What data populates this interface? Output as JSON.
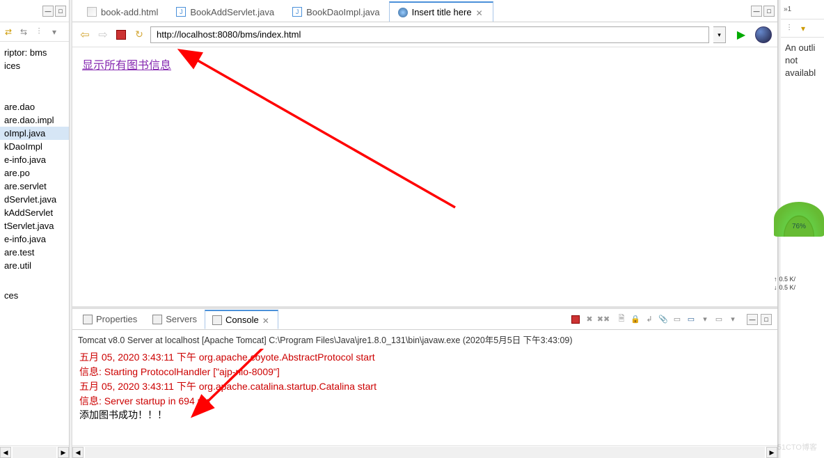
{
  "left": {
    "items": [
      {
        "label": "riptor: bms"
      },
      {
        "label": "ices"
      }
    ],
    "items2": [
      {
        "label": "are.dao"
      },
      {
        "label": "are.dao.impl"
      },
      {
        "label": "oImpl.java",
        "sel": true
      },
      {
        "label": "kDaoImpl"
      },
      {
        "label": "e-info.java"
      },
      {
        "label": "are.po"
      },
      {
        "label": "are.servlet"
      },
      {
        "label": "dServlet.java"
      },
      {
        "label": "kAddServlet"
      },
      {
        "label": "tServlet.java"
      },
      {
        "label": "e-info.java"
      },
      {
        "label": "are.test"
      },
      {
        "label": "are.util"
      }
    ],
    "items3": [
      {
        "label": "ces"
      }
    ]
  },
  "tabs": [
    {
      "icon": "html",
      "label": "book-add.html"
    },
    {
      "icon": "java",
      "label": "BookAddServlet.java"
    },
    {
      "icon": "java",
      "label": "BookDaoImpl.java"
    },
    {
      "icon": "globe",
      "label": "Insert title here",
      "active": true,
      "close": true
    }
  ],
  "browser": {
    "url": "http://localhost:8080/bms/index.html",
    "link": "显示所有图书信息"
  },
  "console": {
    "tabs": [
      {
        "label": "Properties"
      },
      {
        "label": "Servers"
      },
      {
        "label": "Console",
        "active": true
      }
    ],
    "header": "Tomcat v8.0 Server at localhost [Apache Tomcat] C:\\Program Files\\Java\\jre1.8.0_131\\bin\\javaw.exe (2020年5月5日 下午3:43:09)",
    "lines": [
      {
        "cls": "red",
        "text": "五月 05, 2020 3:43:11 下午 org.apache.coyote.AbstractProtocol start"
      },
      {
        "cls": "red",
        "text": "信息: Starting ProtocolHandler [\"ajp-nio-8009\"]"
      },
      {
        "cls": "red",
        "text": "五月 05, 2020 3:43:11 下午 org.apache.catalina.startup.Catalina start"
      },
      {
        "cls": "red",
        "text": "信息: Server startup in 694 ms"
      },
      {
        "cls": "black",
        "text": "添加图书成功！！！"
      }
    ]
  },
  "right": {
    "tab": "1",
    "text1": "An outli",
    "text2": "not",
    "text3": "availabl"
  },
  "widget": {
    "pct": "76%",
    "up": "0.5 K/",
    "dn": "0.5 K/"
  },
  "watermark": "51CTO博客"
}
